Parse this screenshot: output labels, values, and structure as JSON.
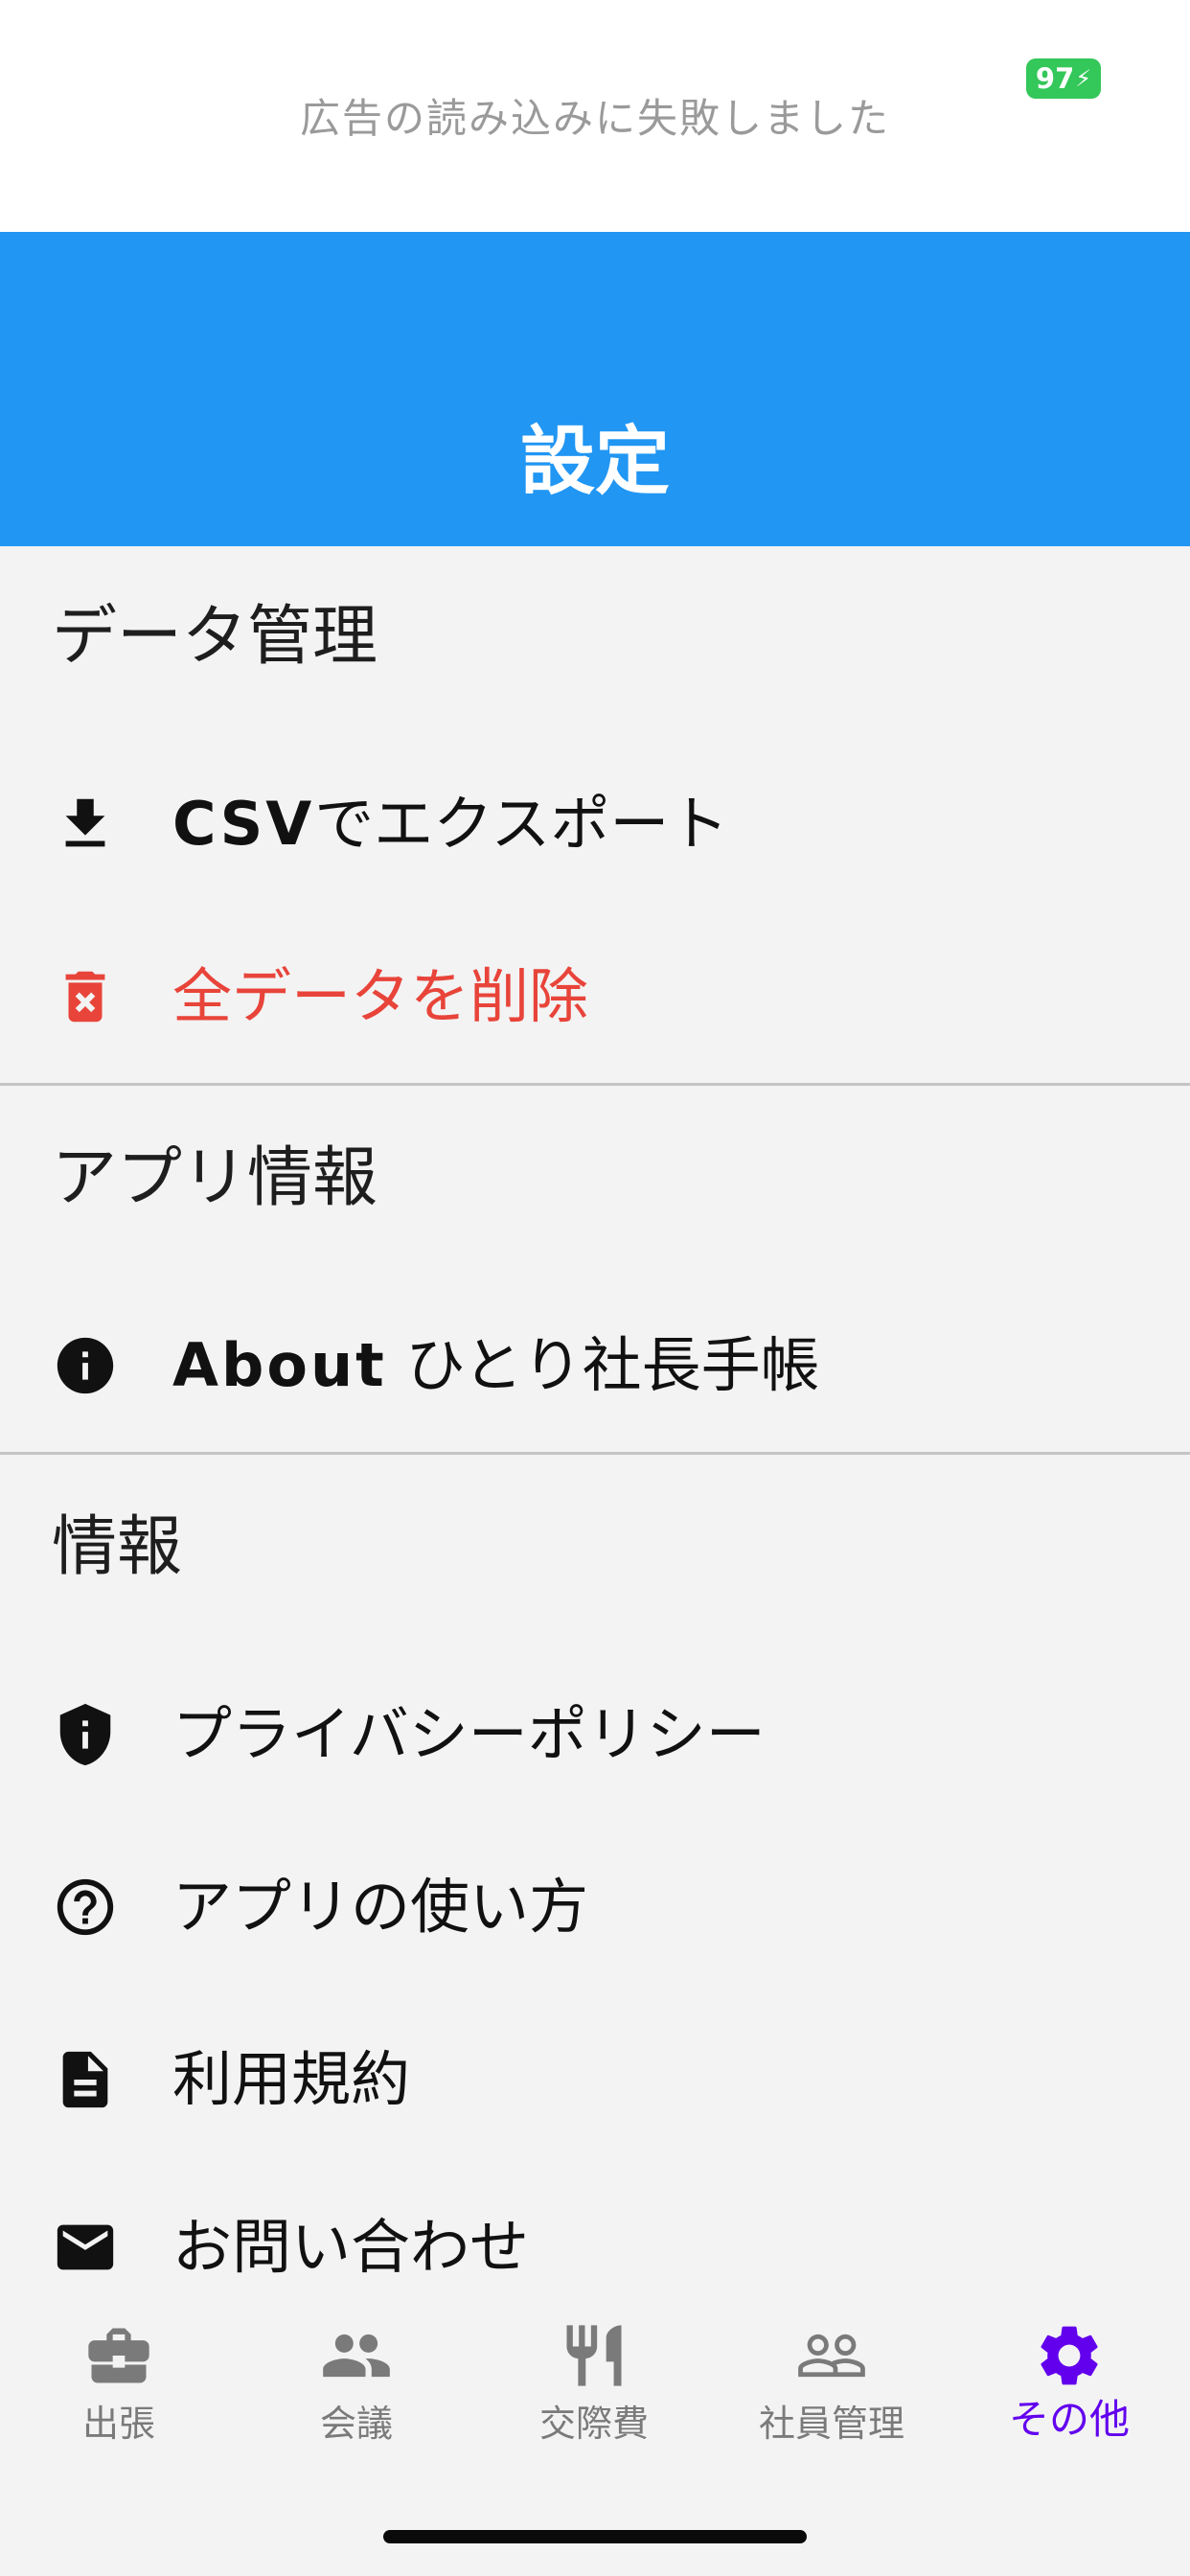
{
  "ad": {
    "text": "広告の読み込みに失敗しました"
  },
  "status": {
    "battery": "97"
  },
  "header": {
    "title": "設定"
  },
  "sections": {
    "data": {
      "title": "データ管理",
      "export_latin": "CSV",
      "export_rest": "でエクスポート",
      "delete": "全データを削除"
    },
    "app": {
      "title": "アプリ情報",
      "about_latin": "About",
      "about_rest": " ひとり社長手帳"
    },
    "info": {
      "title": "情報",
      "privacy": "プライバシーポリシー",
      "howto": "アプリの使い方",
      "terms": "利用規約",
      "contact": "お問い合わせ"
    }
  },
  "tabs": [
    {
      "label": "出張",
      "icon": "briefcase-icon"
    },
    {
      "label": "会議",
      "icon": "people-icon"
    },
    {
      "label": "交際費",
      "icon": "restaurant-icon"
    },
    {
      "label": "社員管理",
      "icon": "people-outline-icon"
    },
    {
      "label": "その他",
      "icon": "gear-icon"
    }
  ],
  "colors": {
    "header": "#2196f3",
    "danger": "#e8443a",
    "active_tab": "#6200ee",
    "battery": "#34c759"
  }
}
